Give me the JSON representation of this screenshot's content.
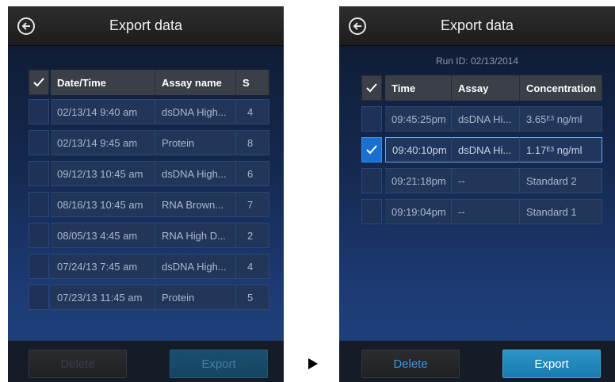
{
  "left": {
    "title": "Export data",
    "headers": [
      "Date/Time",
      "Assay name",
      "S"
    ],
    "rows": [
      {
        "datetime": "02/13/14 9:40 am",
        "assay": "dsDNA High...",
        "s": "4"
      },
      {
        "datetime": "02/13/14 9:45 am",
        "assay": "Protein",
        "s": "8"
      },
      {
        "datetime": "09/12/13 10:45 am",
        "assay": "dsDNA High...",
        "s": "6"
      },
      {
        "datetime": "08/16/13 10:45 am",
        "assay": "RNA Brown...",
        "s": "7"
      },
      {
        "datetime": "08/05/13 4:45 am",
        "assay": "RNA High D...",
        "s": "2"
      },
      {
        "datetime": "07/24/13 7:45 am",
        "assay": "dsDNA High...",
        "s": "4"
      },
      {
        "datetime": "07/23/13 11:45 am",
        "assay": "Protein",
        "s": "5"
      }
    ],
    "delete_label": "Delete",
    "export_label": "Export"
  },
  "right": {
    "title": "Export data",
    "run_id": "Run ID: 02/13/2014",
    "headers": [
      "Time",
      "Assay",
      "Concentration"
    ],
    "rows": [
      {
        "time": "09:45:25pm",
        "assay": "dsDNA Hi...",
        "conc_base": "3.65",
        "conc_exp": "E3",
        "conc_unit": " ng/ml",
        "conc_text": "",
        "checked": false
      },
      {
        "time": "09:40:10pm",
        "assay": "dsDNA Hi...",
        "conc_base": "1.17",
        "conc_exp": "E3",
        "conc_unit": " ng/ml",
        "conc_text": "",
        "checked": true
      },
      {
        "time": "09:21:18pm",
        "assay": "--",
        "conc_base": "",
        "conc_exp": "",
        "conc_unit": "",
        "conc_text": "Standard 2",
        "checked": false
      },
      {
        "time": "09:19:04pm",
        "assay": "--",
        "conc_base": "",
        "conc_exp": "",
        "conc_unit": "",
        "conc_text": "Standard 1",
        "checked": false
      }
    ],
    "delete_label": "Delete",
    "export_label": "Export"
  },
  "icons": {
    "back": "back-arrow-icon",
    "check": "checkmark-icon",
    "next": "play-arrow-icon"
  },
  "colors": {
    "accent": "#1a6fcf",
    "export_button": "#2c95c8"
  }
}
